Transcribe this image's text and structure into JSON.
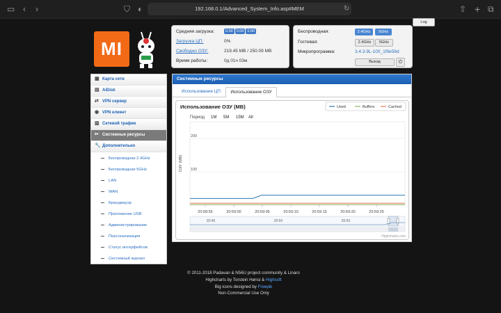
{
  "browser": {
    "url": "192.168.0.1/Advanced_System_Info.asp#MEM"
  },
  "header": {
    "log_button": "Log",
    "logo_text": "MI"
  },
  "status": {
    "load_label": "Средняя загрузка:",
    "load_values": [
      "0.00",
      "0.00",
      "0.00"
    ],
    "cpu_label": "Загрузка ЦП:",
    "cpu_value": "0%",
    "ram_label": "Свободно ОЗУ:",
    "ram_value": "219.45 MB / 250.09 MB",
    "uptime_label": "Время работы:",
    "uptime_value": "0д 01ч 03м"
  },
  "wireless": {
    "wireless_label": "Беспроводная:",
    "guest_label": "Гостевая:",
    "band1": "2.4GHz",
    "band2": "5GHz",
    "firmware_label": "Микропрограмма:",
    "firmware_value": "3.4.3.9L-100_1f9e56d",
    "logout": "Выход",
    "power_icon": "power-icon"
  },
  "menu": {
    "items": [
      {
        "label": "Карта сети",
        "icon": "network-map-icon"
      },
      {
        "label": "AiDisk",
        "icon": "disk-icon"
      },
      {
        "label": "VPN сервер",
        "icon": "vpn-server-icon"
      },
      {
        "label": "VPN клиент",
        "icon": "vpn-client-icon"
      },
      {
        "label": "Сетевой трафик",
        "icon": "traffic-icon"
      },
      {
        "label": "Системные ресурсы",
        "icon": "resources-icon"
      },
      {
        "label": "Дополнительно",
        "icon": "wrench-icon"
      }
    ],
    "subitems": [
      "Беспроводная 2.4GHz",
      "Беспроводная 5GHz",
      "LAN",
      "WAN",
      "Брандмауэр",
      "Приложение USB",
      "Администрирование",
      "Персонализация",
      "Статус интерфейсов",
      "Системный журнал"
    ]
  },
  "main": {
    "title": "Системные ресурсы",
    "tabs": [
      "Использование ЦП",
      "Использование ОЗУ"
    ],
    "period_label": "Период",
    "period_options": [
      "1M",
      "5M",
      "15M",
      "All"
    ],
    "credit": "Highcharts.com"
  },
  "chart_data": {
    "type": "line",
    "title": "Использование ОЗУ (MB)",
    "ylabel": "ОЗУ (MB)",
    "ylim": [
      0,
      250
    ],
    "yticks": [
      100,
      200
    ],
    "xticks": [
      "20:58:55",
      "20:59:00",
      "20:59:05",
      "20:59:10",
      "20:59:15",
      "20:59:20",
      "20:59:25"
    ],
    "navigator_ticks": [
      "20:45",
      "20:50",
      "20:55"
    ],
    "legend_placement": "top-right",
    "series": [
      {
        "name": "Used",
        "color": "#2a7ab0",
        "values": [
          20,
          20,
          20,
          20,
          20,
          20,
          20,
          20,
          30,
          30,
          30,
          30,
          30,
          30,
          30,
          30,
          30,
          30,
          30,
          30,
          30,
          30,
          30,
          30,
          30
        ]
      },
      {
        "name": "Buffers",
        "color": "#8fb56a",
        "values": [
          2,
          2,
          2,
          2,
          2,
          2,
          2,
          2,
          2,
          2,
          2,
          2,
          2,
          2,
          2,
          2,
          2,
          2,
          2,
          2,
          2,
          2,
          2,
          2,
          2
        ]
      },
      {
        "name": "Cached",
        "color": "#e57d57",
        "values": [
          6,
          6,
          6,
          6,
          6,
          6,
          6,
          6,
          6,
          6,
          6,
          6,
          6,
          6,
          6,
          6,
          6,
          6,
          6,
          6,
          6,
          6,
          6,
          6,
          6
        ]
      }
    ]
  },
  "footer": {
    "line1": "© 2011-2018 Padavan & N56U project community & Linaro",
    "line2_prefix": "Highcharts by Torstein Hønsi &",
    "line2_link": "Highsoft",
    "line3_prefix": "Big icons designed by",
    "line3_link": "Freepik",
    "line4": "Non-Commercial Use Only"
  }
}
